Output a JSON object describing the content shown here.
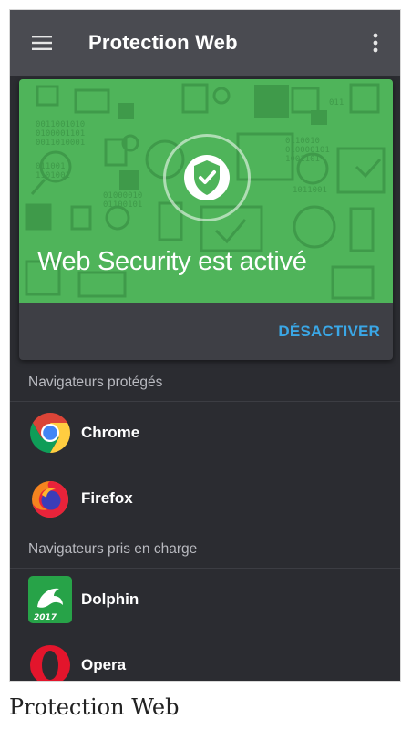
{
  "app": {
    "title": "Protection Web",
    "menu_icon": "hamburger-menu-icon",
    "more_icon": "more-vertical-icon"
  },
  "status_card": {
    "status_text": "Web Security est activé",
    "shield_icon": "shield-check-icon",
    "action_label": "DÉSACTIVER",
    "hero_color": "#4fb45a",
    "accent_color": "#3aa7e6"
  },
  "protected_section": {
    "header": "Navigateurs protégés",
    "browsers": [
      {
        "name": "Chrome",
        "icon": "chrome-icon"
      },
      {
        "name": "Firefox",
        "icon": "firefox-icon"
      }
    ]
  },
  "supported_section": {
    "header": "Navigateurs pris en charge",
    "browsers": [
      {
        "name": "Dolphin",
        "icon": "dolphin-icon",
        "badge": "2017"
      },
      {
        "name": "Opera",
        "icon": "opera-icon"
      }
    ]
  },
  "caption": "Protection Web"
}
